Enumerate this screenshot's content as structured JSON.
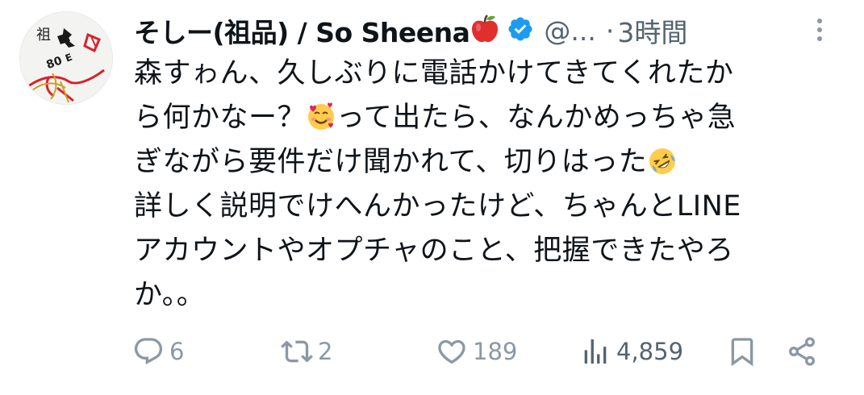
{
  "tweet": {
    "display_name": "そしー(祖品) / So Sheena",
    "name_emoji": "red-apple",
    "verified": true,
    "handle": "@...",
    "separator": "·",
    "timestamp": "3時間",
    "lines": [
      {
        "text": "森すゎん、久しぶりに電話かけてきてくれたか"
      },
      {
        "before": "ら何かなー？",
        "emoji": "smiling-face-with-hearts",
        "after": "って出たら、なんかめっちゃ急"
      },
      {
        "before": "ぎながら要件だけ聞かれて、切りはった",
        "emoji": "rolling-on-floor-laughing",
        "after": ""
      },
      {
        "text": "詳しく説明でけへんかったけど、ちゃんとLINE"
      },
      {
        "text": "アカウントやオプチャのこと、把握できたやろ"
      },
      {
        "text": "か。。"
      }
    ],
    "avatar_text": "祖",
    "actions": {
      "replies": "6",
      "reposts": "2",
      "likes": "189",
      "views": "4,859"
    },
    "colors": {
      "text": "#0f1419",
      "secondary": "#536471",
      "icon": "#8b98a5",
      "verified": "#1d9bf0"
    }
  }
}
